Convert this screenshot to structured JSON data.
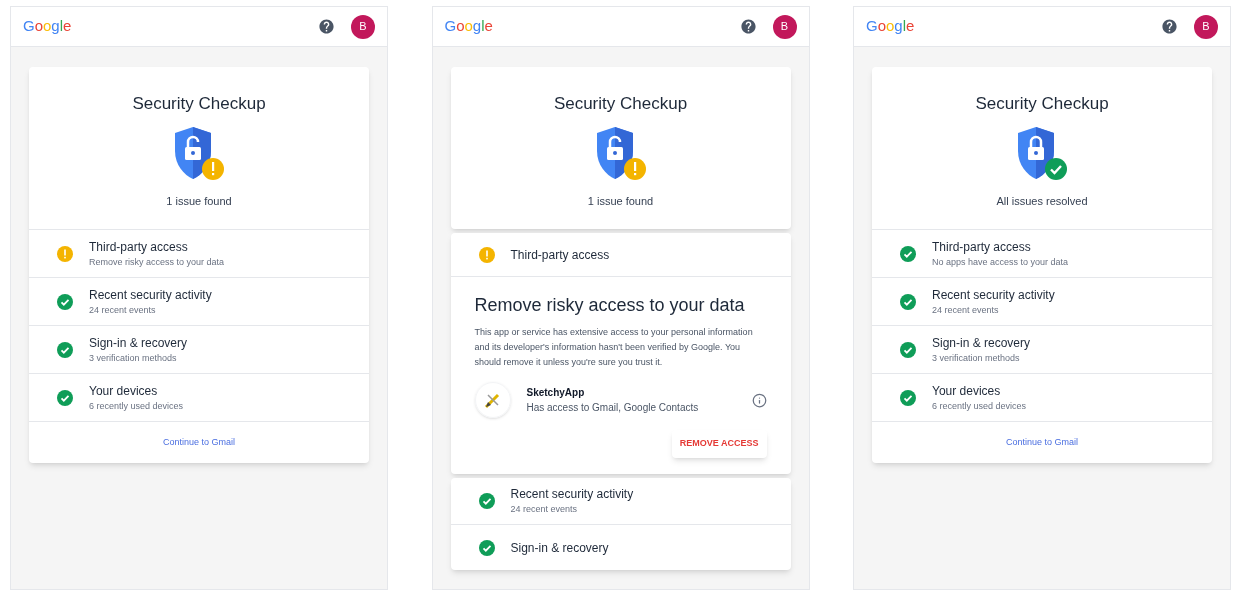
{
  "screens": [
    {
      "header": {
        "logo": "Google",
        "avatar": "B"
      },
      "summary": {
        "title": "Security Checkup",
        "status": "1 issue found",
        "kind": "warning"
      },
      "items": [
        {
          "title": "Third-party access",
          "subtitle": "Remove risky access to your data",
          "kind": "warning",
          "expanded": false
        },
        {
          "title": "Recent security activity",
          "subtitle": "24 recent events",
          "kind": "ok",
          "expanded": false
        },
        {
          "title": "Sign-in & recovery",
          "subtitle": "3 verification methods",
          "kind": "ok",
          "expanded": false
        },
        {
          "title": "Your devices",
          "subtitle": "6 recently used devices",
          "kind": "ok",
          "expanded": false
        }
      ],
      "link": "Continue to Gmail"
    },
    {
      "header": {
        "logo": "Google",
        "avatar": "B"
      },
      "summary": {
        "title": "Security Checkup",
        "status": "1 issue found",
        "kind": "warning"
      },
      "items": [
        {
          "title": "Third-party access",
          "kind": "warning",
          "expanded": true,
          "detail": {
            "heading": "Remove risky access to your data",
            "body": "This app or service has extensive access to your personal information and its developer's information hasn't been verified by Google. You should remove it unless you're sure you trust it.",
            "app_name": "SketchyApp",
            "app_access": "Has access to Gmail, Google Contacts",
            "action": "REMOVE ACCESS"
          }
        },
        {
          "title": "Recent security activity",
          "subtitle": "24 recent events",
          "kind": "ok",
          "expanded": false
        },
        {
          "title": "Sign-in & recovery",
          "kind": "ok",
          "expanded": false
        }
      ]
    },
    {
      "header": {
        "logo": "Google",
        "avatar": "B"
      },
      "summary": {
        "title": "Security Checkup",
        "status": "All issues resolved",
        "kind": "ok"
      },
      "items": [
        {
          "title": "Third-party access",
          "subtitle": "No apps have access to your data",
          "kind": "ok",
          "expanded": false
        },
        {
          "title": "Recent security activity",
          "subtitle": "24 recent events",
          "kind": "ok",
          "expanded": false
        },
        {
          "title": "Sign-in & recovery",
          "subtitle": "3 verification methods",
          "kind": "ok",
          "expanded": false
        },
        {
          "title": "Your devices",
          "subtitle": "6 recently used devices",
          "kind": "ok",
          "expanded": false
        }
      ],
      "link": "Continue to Gmail"
    }
  ]
}
